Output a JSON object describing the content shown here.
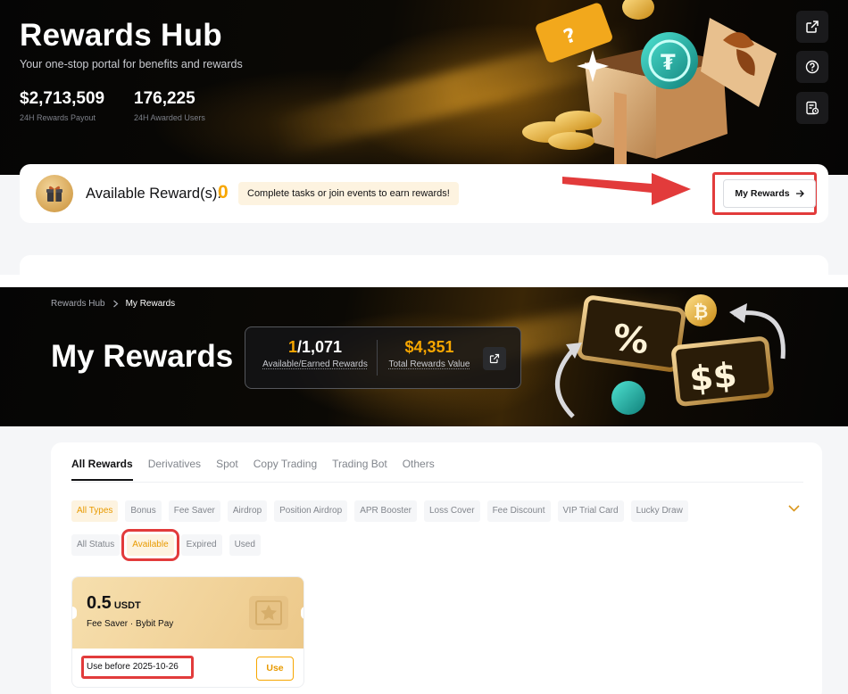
{
  "rewards_hub": {
    "title": "Rewards Hub",
    "subtitle": "Your one-stop portal for benefits and rewards",
    "stats": [
      {
        "value": "$2,713,509",
        "label": "24H Rewards Payout"
      },
      {
        "value": "176,225",
        "label": "24H Awarded Users"
      }
    ],
    "side_buttons": [
      {
        "icon": "external-link-icon"
      },
      {
        "icon": "help-circle-icon"
      },
      {
        "icon": "order-history-icon"
      }
    ],
    "available": {
      "label": "Available Reward(s):",
      "count": "0",
      "tip": "Complete tasks or join events to earn rewards!",
      "my_rewards_button": "My Rewards"
    },
    "annotation_color": "#e23b3b"
  },
  "my_rewards": {
    "breadcrumb": [
      "Rewards Hub",
      "My Rewards"
    ],
    "title": "My Rewards",
    "stats": {
      "available": "1",
      "earned": "/1,071",
      "count_label": "Available/Earned Rewards",
      "total_value": "$4,351",
      "total_label": "Total Rewards Value"
    },
    "tabs": [
      "All Rewards",
      "Derivatives",
      "Spot",
      "Copy Trading",
      "Trading Bot",
      "Others"
    ],
    "active_tab": "All Rewards",
    "types": [
      "All Types",
      "Bonus",
      "Fee Saver",
      "Airdrop",
      "Position Airdrop",
      "APR Booster",
      "Loss Cover",
      "Fee Discount",
      "VIP Trial Card",
      "Lucky Draw"
    ],
    "active_type": "All Types",
    "statuses": [
      "All Status",
      "Available",
      "Expired",
      "Used"
    ],
    "active_status": "Available",
    "card": {
      "amount": "0.5",
      "unit": "USDT",
      "type": "Fee Saver · Bybit Pay",
      "expiry": "Use before 2025-10-26",
      "action": "Use"
    },
    "accent_color": "#f7a600"
  }
}
